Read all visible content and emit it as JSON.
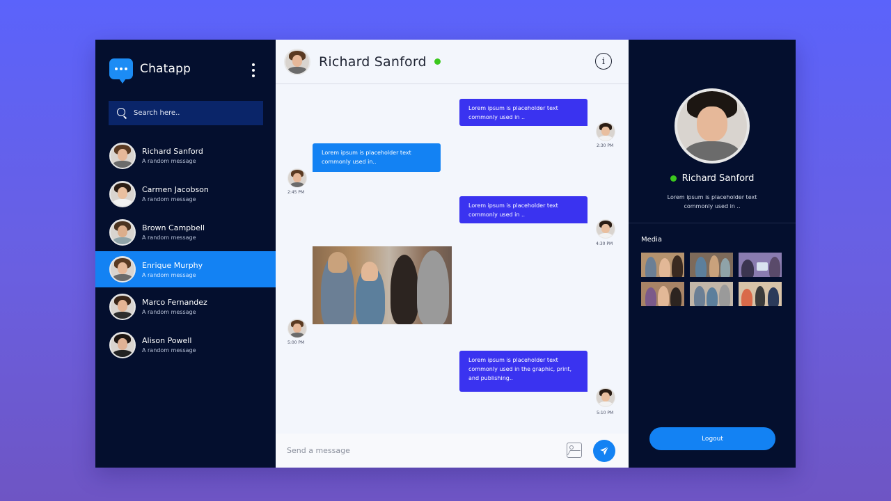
{
  "app": {
    "name": "Chatapp",
    "logo_icon": "chat-bubble-icon",
    "menu_icon": "kebab-menu-icon"
  },
  "search": {
    "placeholder": "Search here..",
    "icon": "search-icon"
  },
  "contacts": [
    {
      "name": "Richard Sanford",
      "message": "A random message",
      "active": false
    },
    {
      "name": "Carmen Jacobson",
      "message": "A random message",
      "active": false
    },
    {
      "name": "Brown Campbell",
      "message": "A random message",
      "active": false
    },
    {
      "name": "Enrique Murphy",
      "message": "A random message",
      "active": true
    },
    {
      "name": "Marco Fernandez",
      "message": "A random message",
      "active": false
    },
    {
      "name": "Alison Powell",
      "message": "A random message",
      "active": false
    }
  ],
  "chat": {
    "title": "Richard Sanford",
    "status": "online",
    "info_icon": "info-icon",
    "messages": [
      {
        "direction": "sent",
        "text": "Lorem ipsum is placeholder text commonly used in ..",
        "time": "2:30 PM"
      },
      {
        "direction": "received",
        "text": "Lorem ipsum is placeholder text commonly used in..",
        "time": "2:45 PM"
      },
      {
        "direction": "sent",
        "text": "Lorem ipsum is placeholder text commonly used in ..",
        "time": "4:30 PM"
      },
      {
        "direction": "received",
        "type": "image",
        "time": "5:00 PM"
      },
      {
        "direction": "sent",
        "text": "Lorem ipsum is placeholder text commonly used in the graphic, print, and publishing..",
        "time": "5:10 PM"
      }
    ],
    "composer": {
      "placeholder": "Send a message",
      "attach_icon": "image-attach-icon",
      "send_icon": "send-icon"
    }
  },
  "profile": {
    "name": "Richard Sanford",
    "status": "online",
    "bio": "Lorem ipsum is placeholder text commonly used in ..",
    "media_label": "Media",
    "media_count": 6,
    "logout_label": "Logout"
  },
  "colors": {
    "accent": "#1382f3",
    "sent_bubble": "#3a33f0",
    "sidebar_bg": "#040f2e",
    "online": "#3cc81e"
  }
}
